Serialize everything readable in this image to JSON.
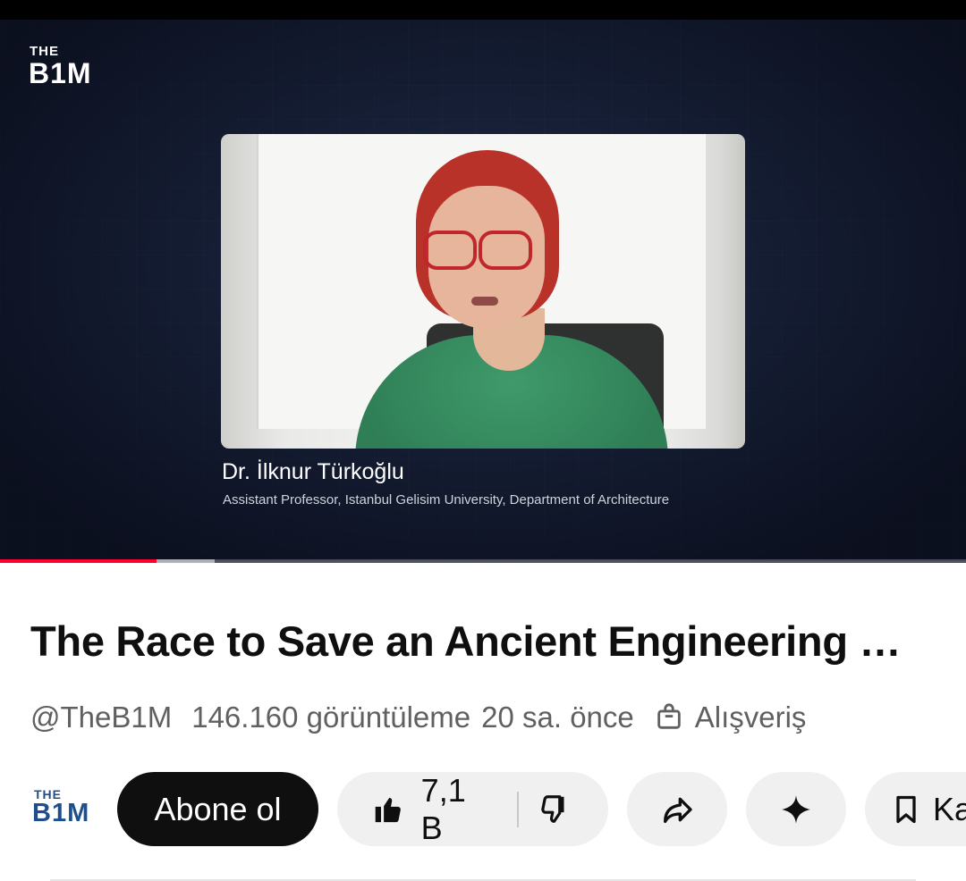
{
  "video": {
    "channel_logo_top": "THE",
    "channel_logo_main": "B1M",
    "speaker_name": "Dr. İlknur Türkoğlu",
    "speaker_title": "Assistant Professor, Istanbul Gelisim University, Department of Architecture",
    "progress_played_fraction": 0.162,
    "progress_buffered_fraction": 0.222,
    "progress_color": "#ff0033"
  },
  "details": {
    "title": "The Race to Save an Ancient Engineering Wonder",
    "channel_handle": "@TheB1M",
    "views": "146.160 görüntüleme",
    "published": "20 sa. önce",
    "shopping_label": "Alışveriş"
  },
  "actions": {
    "channel_logo_top": "THE",
    "channel_logo_main": "B1M",
    "subscribe_label": "Abone ol",
    "like_count": "7,1 B",
    "save_label": "Ka"
  },
  "icons": [
    "thumb-up-icon",
    "thumb-down-icon",
    "share-icon",
    "sparkle-icon",
    "bookmark-icon",
    "shopping-bag-icon"
  ],
  "colors": {
    "accent": "#ff0033",
    "subscribe_bg": "#0f0f0f",
    "pill_bg": "#f0f0f0",
    "logo_blue": "#1f4e8c"
  }
}
